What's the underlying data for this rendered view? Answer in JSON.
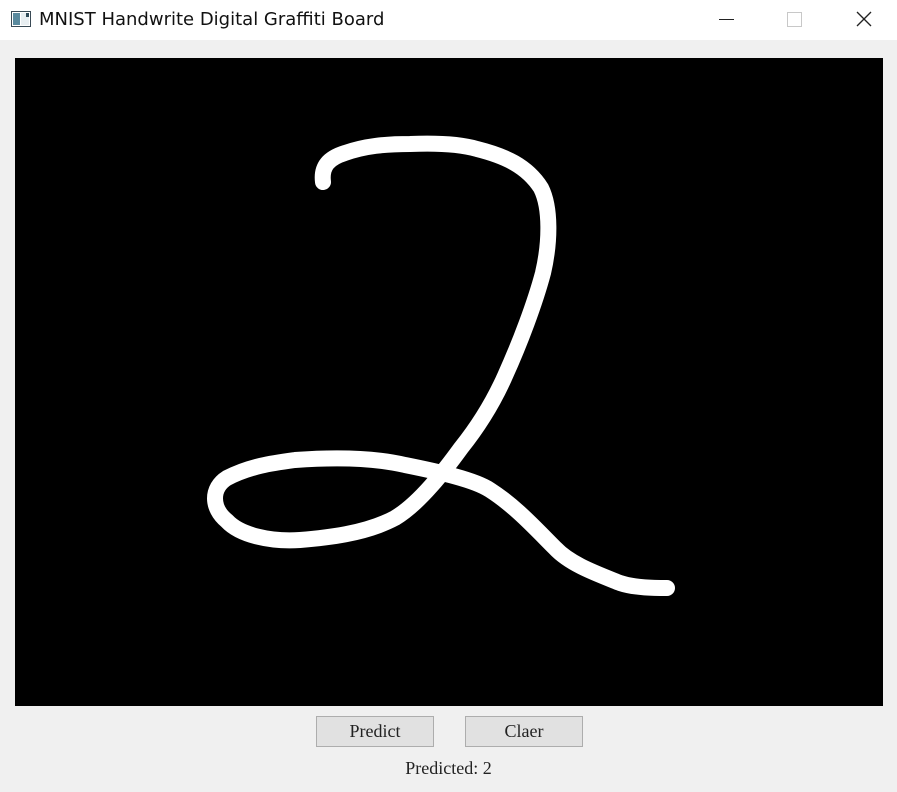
{
  "window": {
    "title": "MNIST Handwrite Digital Graffiti Board",
    "icon": "app-window-icon",
    "controls": {
      "minimize": "minimize-icon",
      "maximize": "maximize-icon",
      "close": "close-icon"
    }
  },
  "canvas": {
    "background": "#000000",
    "stroke_color": "#ffffff"
  },
  "buttons": {
    "predict_label": "Predict",
    "clear_label": "Claer"
  },
  "result": {
    "text": "Predicted: 2"
  }
}
